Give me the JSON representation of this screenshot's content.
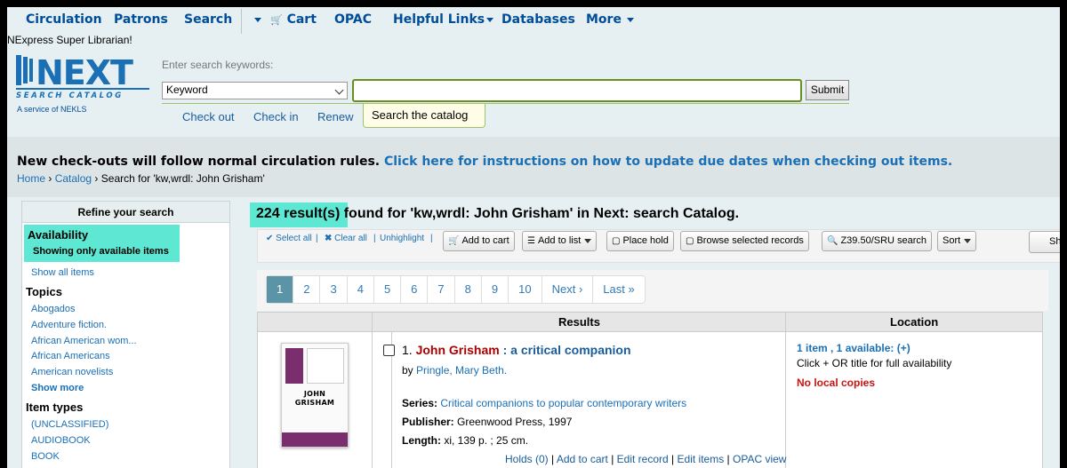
{
  "nav": {
    "circulation": "Circulation",
    "patrons": "Patrons",
    "search": "Search",
    "cart": "Cart",
    "opac": "OPAC",
    "helpful_links": "Helpful Links",
    "databases": "Databases",
    "more": "More"
  },
  "greeting": "NExpress Super Librarian!",
  "logo": {
    "word": "NEXT",
    "sub": "SEARCH CATALOG",
    "service": "A service of NEKLS"
  },
  "search": {
    "label": "Enter search keywords:",
    "type_selected": "Keyword",
    "query": "",
    "submit": "Submit",
    "tabs": [
      "Check out",
      "Check in",
      "Renew"
    ],
    "active_tab": "Search the catalog"
  },
  "notice": {
    "text": "New check-outs will follow normal circulation rules.",
    "link": "Click here for instructions on how to update due dates when checking out items."
  },
  "breadcrumb": {
    "home": "Home",
    "catalog": "Catalog",
    "current": "Search for 'kw,wrdl: John Grisham'"
  },
  "sidebar": {
    "title": "Refine your search",
    "availability": "Availability",
    "showing_only": "Showing only available items",
    "show_all": "Show all items",
    "topics_title": "Topics",
    "topics": [
      "Abogados",
      "Adventure fiction.",
      "African American wom...",
      "African Americans",
      "American novelists"
    ],
    "show_more": "Show more",
    "item_types_title": "Item types",
    "item_types": [
      "(UNCLASSIFIED)",
      "AUDIOBOOK",
      "BOOK"
    ]
  },
  "results": {
    "count": "224 result(s)",
    "found_for": " found for 'kw,wrdl: John Grisham' in Next: search Catalog."
  },
  "toolbar": {
    "select_all": "Select all",
    "clear_all": "Clear all",
    "unhighlight": "Unhighlight",
    "add_to_cart": "Add to cart",
    "add_to_list": "Add to list",
    "place_hold": "Place hold",
    "browse_selected": "Browse selected records",
    "z3950": "Z39.50/SRU search",
    "sort": "Sort",
    "show": "Sh"
  },
  "pagination": {
    "pages": [
      "1",
      "2",
      "3",
      "4",
      "5",
      "6",
      "7",
      "8",
      "9",
      "10"
    ],
    "active": "1",
    "next": "Next",
    "last": "Last"
  },
  "table": {
    "headers": {
      "results": "Results",
      "location": "Location"
    }
  },
  "record": {
    "number": "1.",
    "title_hl": "John Grisham",
    "title_rest": " : a critical companion",
    "by": "by",
    "author": "Pringle, Mary Beth.",
    "series_label": "Series:",
    "series": "Critical companions to popular contemporary writers",
    "publisher_label": "Publisher:",
    "publisher": "Greenwood Press, 1997",
    "length_label": "Length:",
    "length": "xi, 139 p. ; 25 cm.",
    "links": [
      "Holds (0)",
      "Add to cart",
      "Edit record",
      "Edit items",
      "OPAC view"
    ],
    "location_avail": "1 item , 1 available: (+)",
    "location_hint": "Click + OR title for full availability",
    "location_status": "No local copies",
    "cover": {
      "title_line1": "JOHN",
      "title_line2": "GRISHAM"
    }
  },
  "colors": {
    "nav_text": "#004d99",
    "highlight": "#5ee8d4",
    "page_bg": "#e6f0f2",
    "pager_active": "#5b94a6",
    "error": "#cc1111"
  }
}
